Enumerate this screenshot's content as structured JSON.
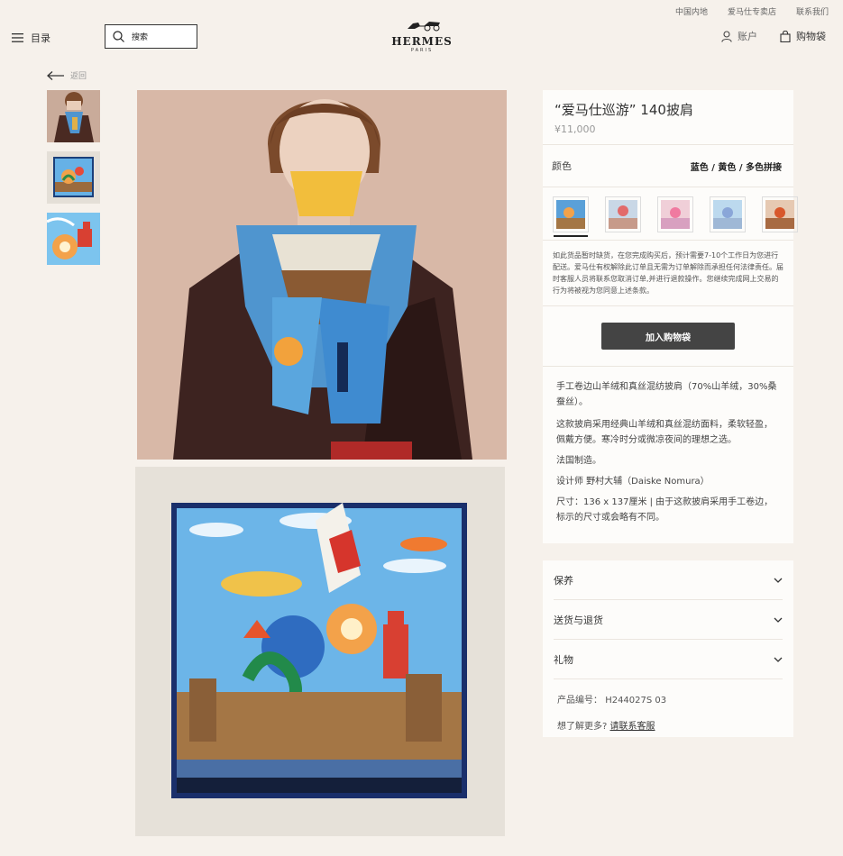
{
  "topbar": [
    "中国内地",
    "爱马仕专卖店",
    "联系我们"
  ],
  "header": {
    "menu_label": "目录",
    "search_label": "搜索",
    "logo_word": "HERMES",
    "logo_sub": "PARIS",
    "account_label": "账户",
    "bag_label": "购物袋"
  },
  "back_label": "返回",
  "product": {
    "title": "“爱马仕巡游” 140披肩",
    "price": "¥11,000",
    "color_label": "颜色",
    "color_value": "蓝色 / 黄色 / 多色拼接",
    "notice": "如此货品暂时缺货，在您完成购买后，预计需要7-10个工作日为您进行配送。爱马仕有权解除此订单且无需为订单解除而承担任何法律责任。届时客服人员将联系您取消订单,并进行退款操作。您继续完成网上交易的行为将被视为您同意上述条款。",
    "add_button": "加入购物袋",
    "desc1": "手工卷边山羊绒和真丝混纺披肩（70%山羊绒，30%桑蚕丝）。",
    "desc2": "这款披肩采用经典山羊绒和真丝混纺面料，柔软轻盈，佩戴方便。寒冷时分或微凉夜间的理想之选。",
    "desc3": "法国制造。",
    "desc4": "设计师 野村大辅（Daiske Nomura）",
    "desc5": "尺寸：136 x 137厘米 | 由于这款披肩采用手工卷边，标示的尺寸或会略有不同。"
  },
  "accordion": [
    "保养",
    "送货与退货",
    "礼物"
  ],
  "meta": {
    "sku_label": "产品编号：",
    "sku": "H244027S 03",
    "more_label": "想了解更多?",
    "more_link": "请联系客服"
  },
  "colors": {
    "swatch_bg": [
      "#5aa0d8",
      "#c9d7e6",
      "#f0cfd8",
      "#bcd9ee",
      "#e6c9b2"
    ],
    "accent": "#444444"
  }
}
